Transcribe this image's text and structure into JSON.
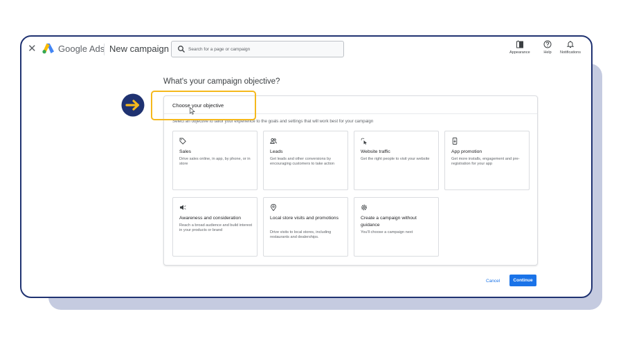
{
  "header": {
    "close_glyph": "✕",
    "brand": "Google Ads",
    "page_title": "New campaign",
    "search": {
      "placeholder": "Search for a page or campaign",
      "value": ""
    },
    "actions": [
      {
        "label": "Appearance",
        "icon": "appearance-icon"
      },
      {
        "label": "Help",
        "icon": "help-icon"
      },
      {
        "label": "Notifications",
        "icon": "bell-icon"
      }
    ]
  },
  "main": {
    "question": "What's your campaign objective?",
    "panel_title": "Choose your objective",
    "panel_description": "Select an objective to tailor your experience to the goals and settings that will work best for your campaign",
    "objectives": [
      {
        "icon": "tag-icon",
        "title": "Sales",
        "description": "Drive sales online, in app, by phone, or in store"
      },
      {
        "icon": "people-icon",
        "title": "Leads",
        "description": "Get leads and other conversions by encouraging customers to take action"
      },
      {
        "icon": "cursor-click-icon",
        "title": "Website traffic",
        "description": "Get the right people to visit your website"
      },
      {
        "icon": "phone-icon",
        "title": "App promotion",
        "description": "Get more installs, engagement and pre-registration for your app"
      },
      {
        "icon": "megaphone-icon",
        "title": "Awareness and consideration",
        "description": "Reach a broad audience and build interest in your products or brand"
      },
      {
        "icon": "location-pin-icon",
        "title": "Local store visits and promotions",
        "description": "Drive visits to local stores, including restaurants and dealerships."
      },
      {
        "icon": "settings-gear-icon",
        "title": "Create a campaign without guidance",
        "description": "You'll choose a campaign next"
      }
    ],
    "cancel_label": "Cancel",
    "continue_label": "Continue"
  },
  "colors": {
    "frame_border": "#1f3271",
    "shadow_card": "#c5cbe0",
    "highlight": "#f5b81c",
    "arrow_badge": "#1f3271",
    "primary_blue": "#1a73e8"
  }
}
